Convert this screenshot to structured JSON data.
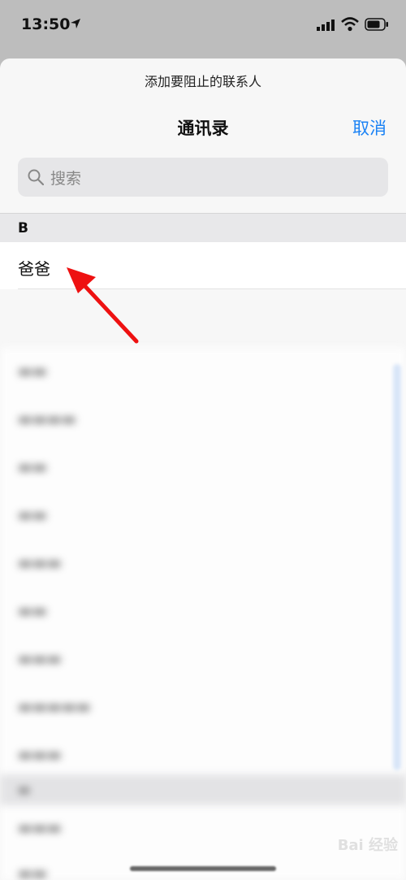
{
  "status": {
    "time": "13:50"
  },
  "sheet": {
    "prompt": "添加要阻止的联系人",
    "title": "通讯录",
    "cancel": "取消",
    "search_placeholder": "搜索"
  },
  "list": {
    "section": "B",
    "first_contact": "爸爸"
  },
  "watermark": "Bai 经验",
  "colors": {
    "accent": "#1a82f5",
    "arrow": "#e11"
  },
  "icons": [
    "location-arrow-icon",
    "cellular-signal-icon",
    "wifi-icon",
    "battery-icon",
    "search-icon"
  ]
}
